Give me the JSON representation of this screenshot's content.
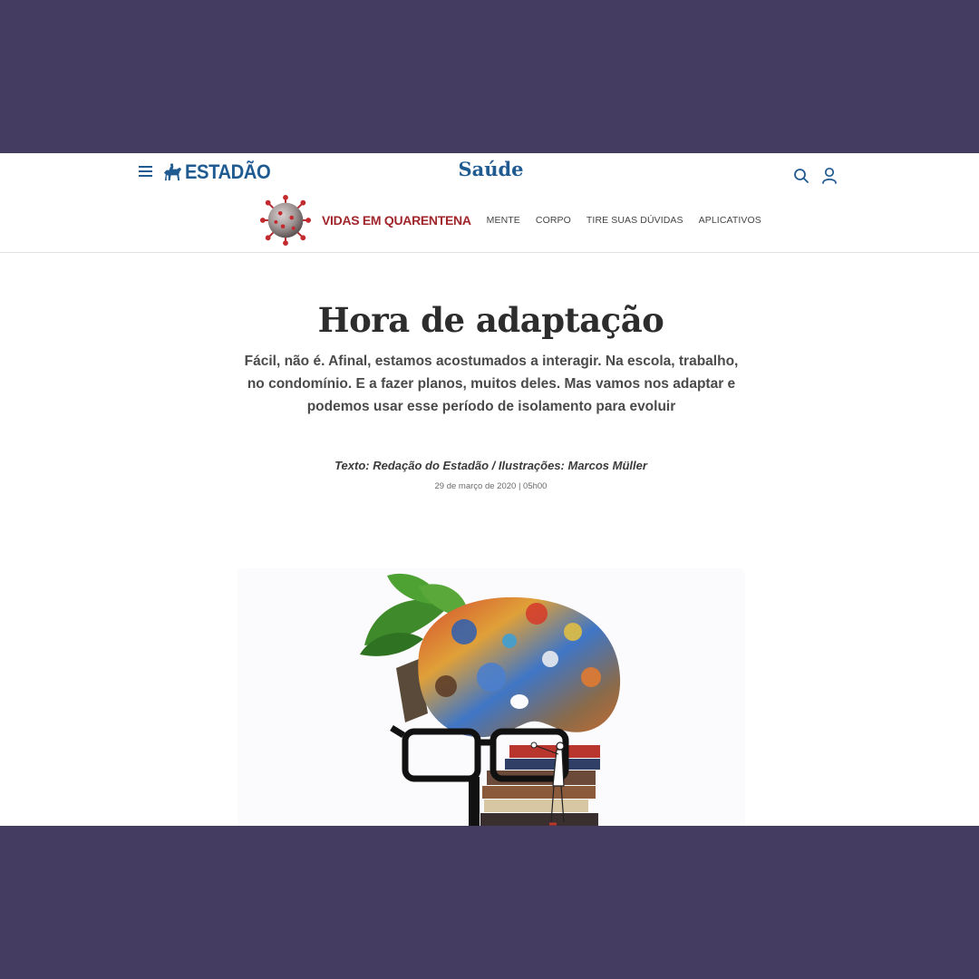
{
  "header": {
    "logo_text": "ESTADÃO",
    "section_title": "Saúde"
  },
  "subnav": {
    "special_label": "VIDAS EM QUARENTENA",
    "items": [
      "MENTE",
      "CORPO",
      "TIRE SUAS DÚVIDAS",
      "APLICATIVOS"
    ]
  },
  "article": {
    "headline": "Hora de adaptação",
    "subhead": "Fácil, não é. Afinal, estamos acostumados a interagir. Na escola, trabalho, no condomínio. E a fazer planos, muitos deles. Mas vamos nos adaptar e podemos usar esse período de isolamento para evoluir",
    "credits": "Texto: Redação do Estadão / Ilustrações: Marcos Müller",
    "dateline": "29 de março de 2020 | 05h00"
  },
  "icons": {
    "menu": "hamburger-menu-icon",
    "logo_mark": "horse-rider-icon",
    "search": "search-icon",
    "user": "user-icon",
    "special": "coronavirus-icon"
  },
  "colors": {
    "background_outer": "#453c61",
    "brand_blue": "#1f5a91",
    "special_red": "#a0262c",
    "headline_text": "#2d2d2d"
  }
}
